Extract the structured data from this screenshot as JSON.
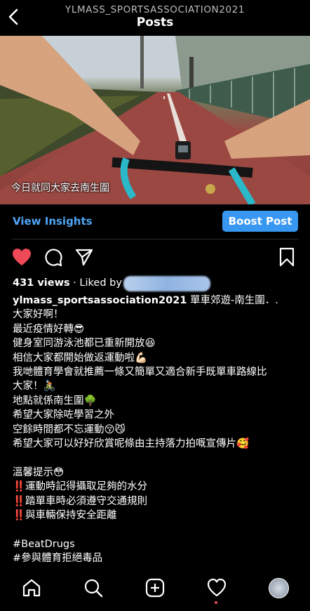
{
  "header": {
    "username": "YLMASS_SPORTSASSOCIATION2021",
    "title": "Posts"
  },
  "video": {
    "caption": "今日就同大家去南生圍"
  },
  "insights": {
    "view_label": "View Insights",
    "boost_label": "Boost Post"
  },
  "stats": {
    "views": "431 views",
    "liked_by": "· Liked by"
  },
  "post": {
    "username": "ylmass_sportsassociation2021",
    "lines": [
      "單車郊遊-南生圍．.",
      "大家好啊！",
      "最近疫情好轉😎",
      "健身室同游泳池都已重新開放😆",
      "相信大家都開始做返運動啦💪🏻",
      "我哋體育學會就推薦一條又簡單又適合新手既單車路線比",
      "大家！🚴🏻",
      "地點就係南生圍🌳",
      "希望大家除咗學習之外",
      "空餘時間都不忘運動😚😼",
      "希望大家可以好好欣賞呢條由主持落力拍嘅宣傳片🥰",
      "",
      "溫馨提示😳",
      "‼️運動時記得攝取足夠的水分",
      "‼️踏單車時必須遵守交通規則",
      "‼️與車輛保持安全距離",
      "",
      "#BeatDrugs",
      "#參與體育拒絕毒品"
    ]
  },
  "colors": {
    "accent_blue": "#3897f0",
    "like_red": "#ed4956"
  }
}
